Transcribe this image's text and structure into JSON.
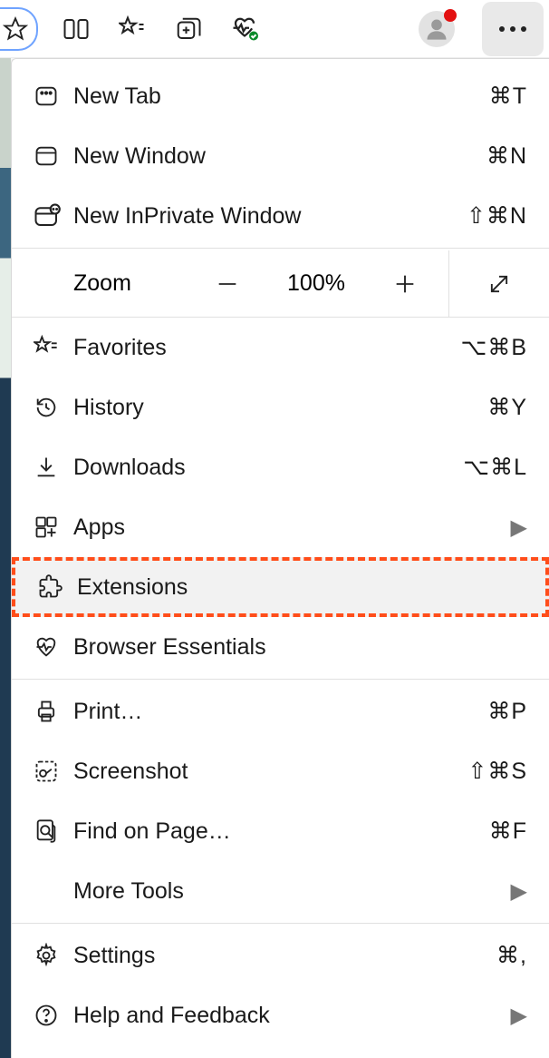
{
  "toolbar": {
    "more_icon": "···"
  },
  "menu": {
    "new_tab": {
      "label": "New Tab",
      "shortcut": "⌘T"
    },
    "new_window": {
      "label": "New Window",
      "shortcut": "⌘N"
    },
    "new_inprivate": {
      "label": "New InPrivate Window",
      "shortcut": "⇧⌘N"
    },
    "zoom": {
      "label": "Zoom",
      "value": "100%"
    },
    "favorites": {
      "label": "Favorites",
      "shortcut": "⌥⌘B"
    },
    "history": {
      "label": "History",
      "shortcut": "⌘Y"
    },
    "downloads": {
      "label": "Downloads",
      "shortcut": "⌥⌘L"
    },
    "apps": {
      "label": "Apps"
    },
    "extensions": {
      "label": "Extensions"
    },
    "browser_essentials": {
      "label": "Browser Essentials"
    },
    "print": {
      "label": "Print…",
      "shortcut": "⌘P"
    },
    "screenshot": {
      "label": "Screenshot",
      "shortcut": "⇧⌘S"
    },
    "find": {
      "label": "Find on Page…",
      "shortcut": "⌘F"
    },
    "more_tools": {
      "label": "More Tools"
    },
    "settings": {
      "label": "Settings",
      "shortcut": "⌘,"
    },
    "help": {
      "label": "Help and Feedback"
    }
  }
}
